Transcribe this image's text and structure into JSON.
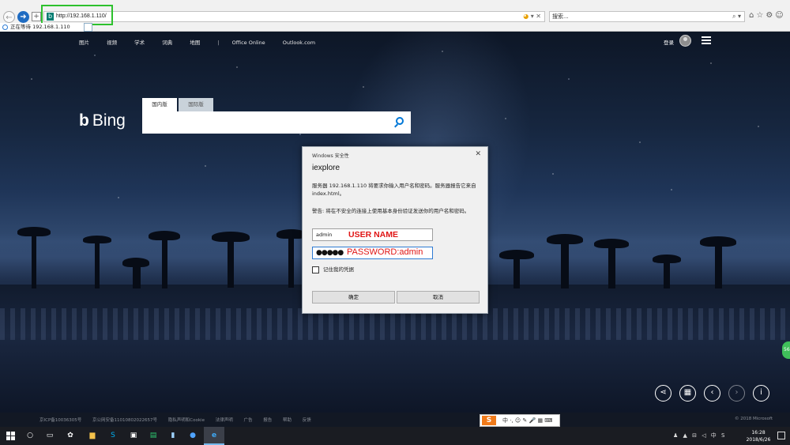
{
  "browser": {
    "back_icon": "←",
    "forward_icon": "➜",
    "refresh_icon": "+",
    "favicon_letter": "b",
    "address": "http://192.168.1.110/",
    "address_icons": "✕",
    "search_placeholder": "搜索...",
    "search_icons": "⌕ ▾",
    "right_icons": "⌂☆⚙☺",
    "tab_label": "正在等待 192.168.1.110",
    "highlight_color": "#2dc12d"
  },
  "bing": {
    "nav": [
      "图片",
      "视频",
      "学术",
      "词典",
      "地图"
    ],
    "nav_extra": [
      "Office Online",
      "Outlook.com"
    ],
    "login": "登录",
    "logo_text": "Bing",
    "search_tabs": [
      "国内版",
      "国际版"
    ],
    "brand_color": "#0078d7"
  },
  "dialog": {
    "title": "Windows 安全性",
    "app_name": "iexplore",
    "message": "服务器 192.168.1.110 将要求你输入用户名和密码。服务器报告它来自 index.html。",
    "warning": "警告: 将在不安全的连接上使用基本身份验证发送你的用户名和密码。",
    "username_value": "admin",
    "password_dots": "●●●●●",
    "annotation_user": "USER NAME",
    "annotation_pass": "PASSWORD:admin",
    "remember_label": "记住我的凭据",
    "ok_label": "确定",
    "cancel_label": "取消",
    "annotation_color": "#e01515"
  },
  "page_controls": {
    "share_icon": "⋖",
    "qr_icon": "▦",
    "prev_icon": "‹",
    "next_icon": "›",
    "info_icon": "i",
    "side_badge": "56"
  },
  "footer": {
    "links": [
      "京ICP备10036305号",
      "京公网安备11010802022657号",
      "隐私声明和Cookie",
      "法律声明",
      "广告",
      "报告",
      "帮助",
      "反馈"
    ],
    "copyright": "© 2018 Microsoft"
  },
  "ime": {
    "logo": "S",
    "text": "中 ·, ☺ ✎ 🎤 ▦ ⌨"
  },
  "taskbar": {
    "tray": "♟ ▲ ⊟ ◁ 中 S",
    "time": "16:28",
    "date": "2018/6/26"
  }
}
